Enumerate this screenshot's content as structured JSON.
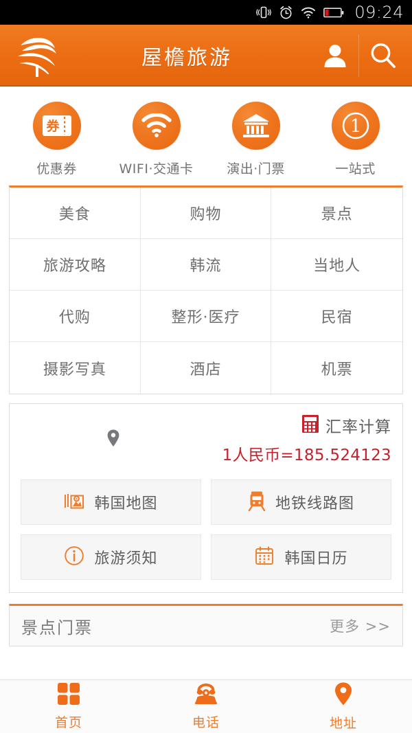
{
  "statusbar": {
    "time": "09:24",
    "icons": [
      "vibrate-icon",
      "alarm-icon",
      "wifi-icon",
      "battery-low-icon"
    ]
  },
  "header": {
    "logo_name": "app-logo",
    "title": "屋檐旅游",
    "user_button": "user-icon",
    "search_button": "search-icon",
    "bg_color": "#ee731a"
  },
  "quick_actions": [
    {
      "label": "优惠券",
      "icon": "coupon-icon"
    },
    {
      "label": "WIFI·交通卡",
      "icon": "wifi-circle-icon"
    },
    {
      "label": "演出·门票",
      "icon": "museum-icon"
    },
    {
      "label": "一站式",
      "icon": "number-one-icon"
    }
  ],
  "category_grid": {
    "accent_color": "#ef7d2c",
    "items": [
      "美食",
      "购物",
      "景点",
      "旅游攻略",
      "韩流",
      "当地人",
      "代购",
      "整形·医疗",
      "民宿",
      "摄影写真",
      "酒店",
      "机票"
    ]
  },
  "tools": {
    "location_icon": "map-pin-icon",
    "rate": {
      "icon": "calculator-icon",
      "icon_color": "#c9202a",
      "label": "汇率计算",
      "value": "1人民币=185.524123",
      "value_color": "#c9202a"
    },
    "buttons": [
      {
        "label": "韩国地图",
        "icon": "map-icon"
      },
      {
        "label": "地铁线路图",
        "icon": "subway-icon"
      },
      {
        "label": "旅游须知",
        "icon": "info-icon"
      },
      {
        "label": "韩国日历",
        "icon": "calendar-icon"
      }
    ]
  },
  "tickets": {
    "title": "景点门票",
    "more": "更多 >>"
  },
  "tabbar": {
    "accent_color": "#ef7d2c",
    "items": [
      {
        "label": "首页",
        "icon": "grid-icon"
      },
      {
        "label": "电话",
        "icon": "phone-icon"
      },
      {
        "label": "地址",
        "icon": "location-pin-icon"
      }
    ]
  }
}
